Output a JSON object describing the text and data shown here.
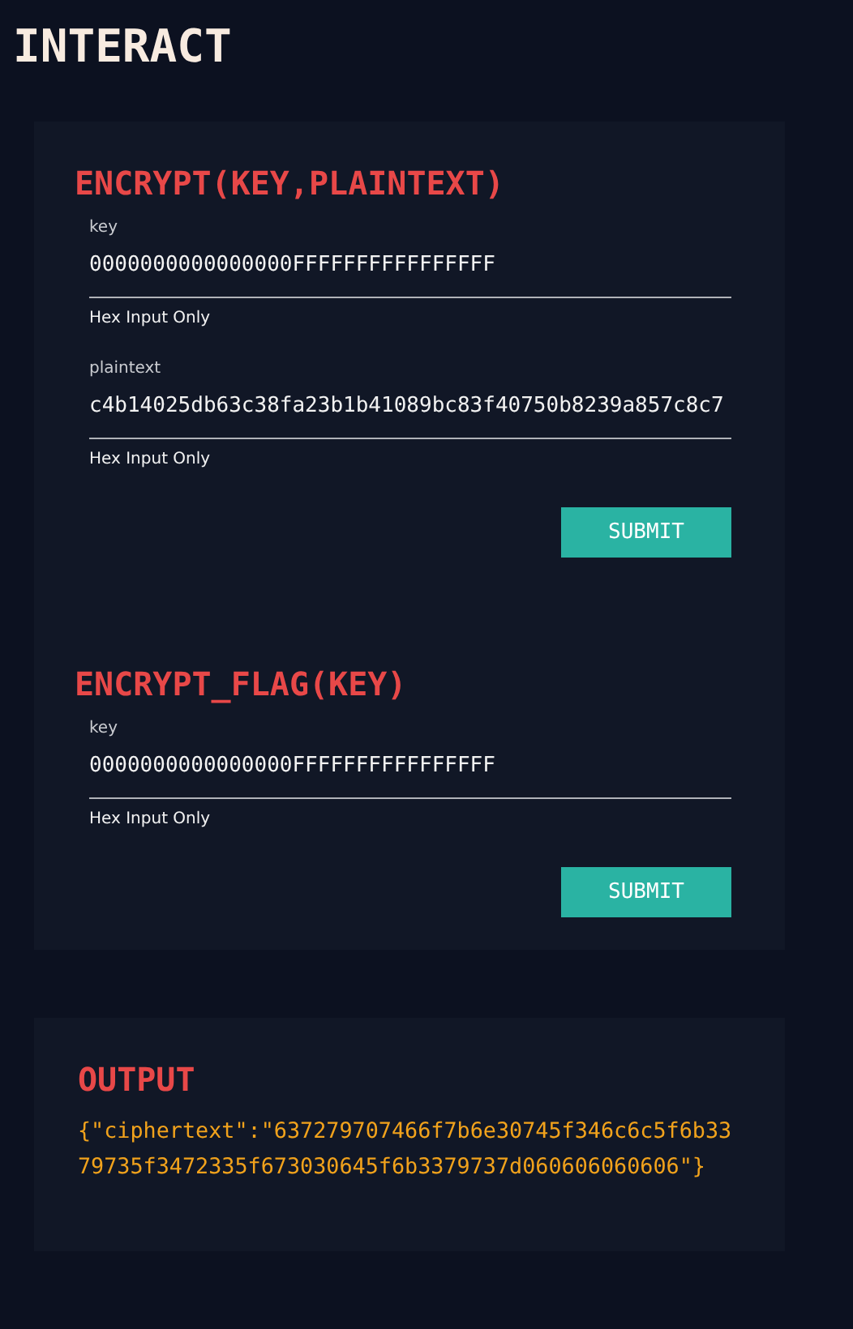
{
  "page_title": "INTERACT",
  "forms": [
    {
      "title": "ENCRYPT(KEY,PLAINTEXT)",
      "fields": [
        {
          "label": "key",
          "value": "0000000000000000FFFFFFFFFFFFFFFF",
          "hint": "Hex Input Only"
        },
        {
          "label": "plaintext",
          "value": "c4b14025db63c38fa23b1b41089bc83f40750b8239a857c8c7",
          "hint": "Hex Input Only"
        }
      ],
      "button": "SUBMIT"
    },
    {
      "title": "ENCRYPT_FLAG(KEY)",
      "fields": [
        {
          "label": "key",
          "value": "0000000000000000FFFFFFFFFFFFFFFF",
          "hint": "Hex Input Only"
        }
      ],
      "button": "SUBMIT"
    }
  ],
  "output": {
    "title": "OUTPUT",
    "text": "{\"ciphertext\":\"637279707466f7b6e30745f346c6c5f6b3379735f3472335f673030645f6b3379737d060606060606\"}"
  }
}
